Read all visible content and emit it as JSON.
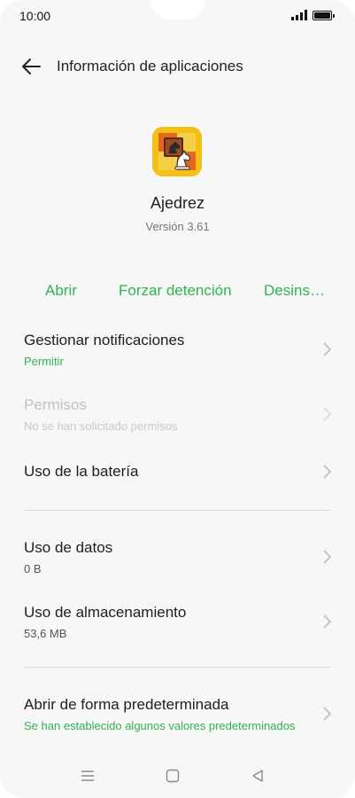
{
  "status": {
    "time": "10:00"
  },
  "appbar": {
    "title": "Información de aplicaciones",
    "back_icon": "arrow-left-icon"
  },
  "app": {
    "name": "Ajedrez",
    "version": "Versión 3.61",
    "icon": "chess-app-icon"
  },
  "actions": {
    "open": "Abrir",
    "force_stop": "Forzar detención",
    "uninstall": "Desins…"
  },
  "colors": {
    "accent": "#2fb54f",
    "background": "#f7f7f7",
    "disabled": "#c2c2c2"
  },
  "rows": [
    {
      "title": "Gestionar notificaciones",
      "subtitle": "Permitir"
    },
    {
      "title": "Permisos",
      "subtitle": "No se han solicitado permisos"
    },
    {
      "title": "Uso de la batería",
      "subtitle": ""
    },
    {
      "title": "Uso de datos",
      "subtitle": "0 B"
    },
    {
      "title": "Uso de almacenamiento",
      "subtitle": "53,6 MB"
    },
    {
      "title": "Abrir de forma predeterminada",
      "subtitle": "Se han establecido algunos valores predeterminados"
    }
  ],
  "navbar": {
    "menu_icon": "menu-icon",
    "home_icon": "home-square-icon",
    "back_icon": "back-triangle-icon"
  }
}
